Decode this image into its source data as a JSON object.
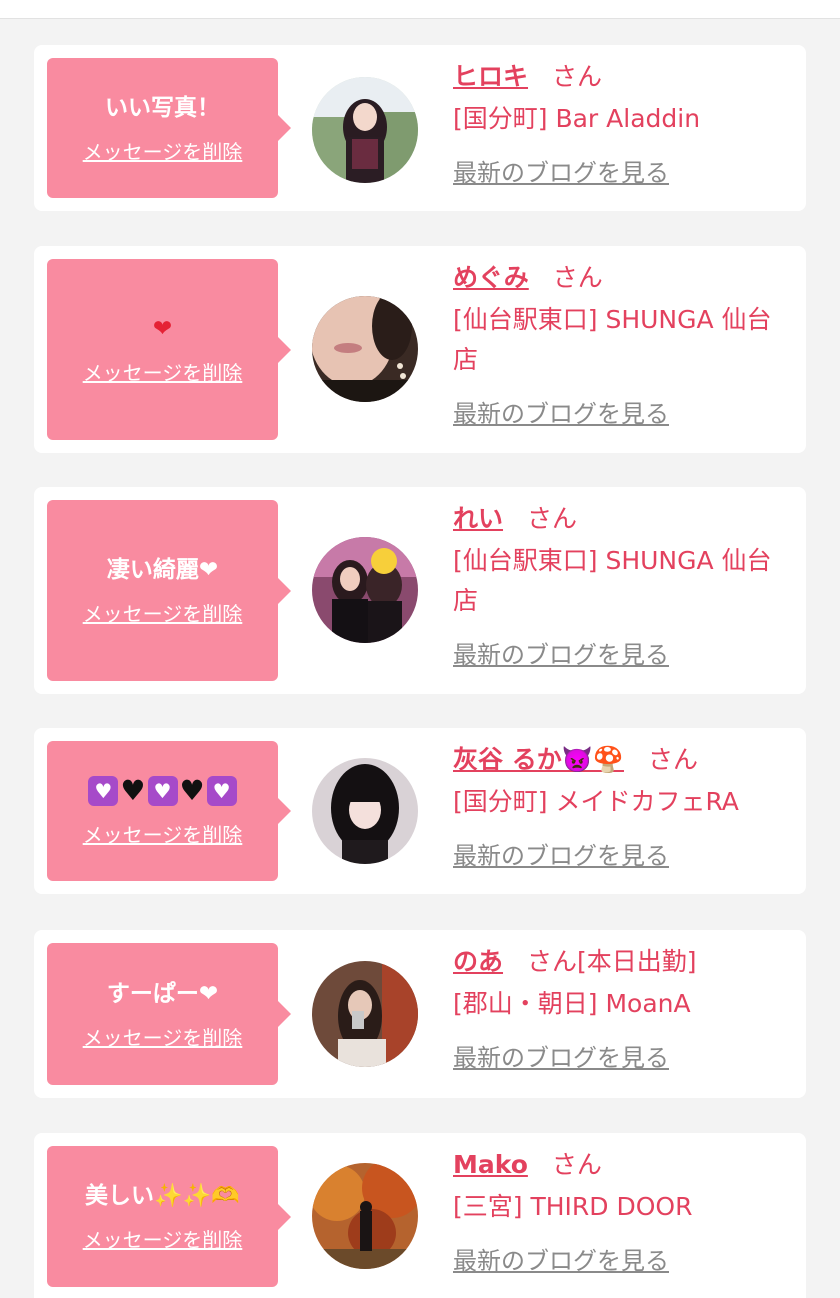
{
  "common": {
    "delete_label": "メッセージを削除",
    "blog_label": "最新のブログを見る",
    "honorific": "さん"
  },
  "items": [
    {
      "message": "いい写真！",
      "name": "ヒロキ",
      "suffix": "",
      "shop": "[国分町] Bar Aladdin"
    },
    {
      "message": "❤",
      "name": "めぐみ",
      "suffix": "",
      "shop": "[仙台駅東口] SHUNGA 仙台店"
    },
    {
      "message": "凄い綺麗❤",
      "name": "れい",
      "suffix": "",
      "shop": "[仙台駅東口] SHUNGA 仙台店"
    },
    {
      "message": "💜🖤💜🖤💜",
      "name": "灰谷 るか👿🍄",
      "suffix": "",
      "shop": "[国分町] メイドカフェRA"
    },
    {
      "message": "すーぱー❤",
      "name": "のあ",
      "suffix": "[本日出勤]",
      "shop": "[郡山・朝日] MoanA"
    },
    {
      "message": "美しい✨✨🫶",
      "name": "Mako",
      "suffix": "",
      "shop": "[三宮] THIRD DOOR"
    }
  ],
  "colors": {
    "bubble": "#f98ba0",
    "accent": "#e3415e",
    "link_gray": "#8a8a8a",
    "background": "#f3f3f3"
  }
}
